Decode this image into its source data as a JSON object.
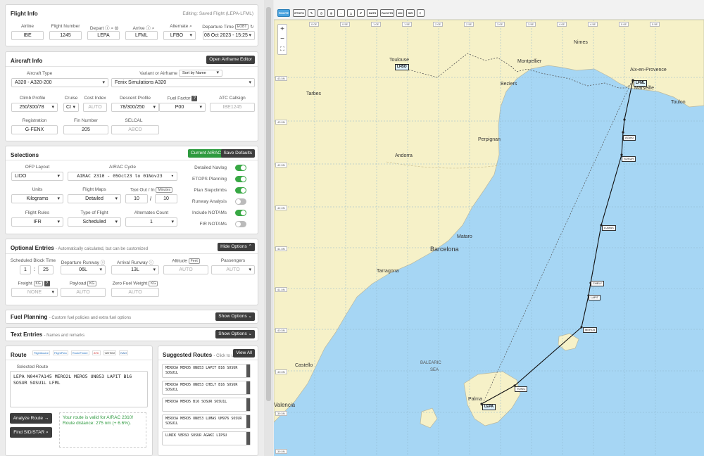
{
  "flight_info": {
    "title": "Flight Info",
    "editing": "Editing: Saved Flight (LEPA-LFML)",
    "labels": {
      "airline": "Airline",
      "flight_number": "Flight Number",
      "depart": "Depart",
      "arrive": "Arrive",
      "alternate": "Alternate",
      "departure_time": "Departure Time",
      "departure_time_unit": "EOBT"
    },
    "values": {
      "airline": "IBE",
      "flight_number": "1245",
      "depart": "LEPA",
      "arrive": "LFML",
      "alternate": "LFBO",
      "departure_time": "08 Oct 2023 - 15:25"
    }
  },
  "aircraft_info": {
    "title": "Aircraft Info",
    "open_editor": "Open Airframe Editor",
    "labels": {
      "aircraft_type": "Aircraft Type",
      "variant": "Variant or Airframe",
      "climb": "Climb Profile",
      "cruise": "Cruise",
      "cost_index": "Cost Index",
      "descent": "Descent Profile",
      "fuel_factor": "Fuel Factor",
      "atc_callsign": "ATC Callsign",
      "registration": "Registration",
      "fin_number": "Fin Number",
      "selcal": "SELCAL"
    },
    "sort_by": "Sort by Name",
    "values": {
      "aircraft_type": "A320 - A320-200",
      "variant": "Fenix Simulations A320",
      "climb": "250/300/78",
      "cruise": "CI",
      "cost_index": "AUTO",
      "descent": "78/300/250",
      "fuel_factor": "P00",
      "atc_callsign": "IBE1245",
      "registration": "G-FENX",
      "fin_number": "205",
      "selcal": "ABCD"
    }
  },
  "selections": {
    "title": "Selections",
    "current_airac": "Current AIRAC",
    "save_defaults": "Save Defaults",
    "labels": {
      "ofp_layout": "OFP Layout",
      "airac_cycle": "AIRAC Cycle",
      "units": "Units",
      "flight_maps": "Flight Maps",
      "taxi": "Taxi Out / In",
      "taxi_unit": "Minutes",
      "flight_rules": "Flight Rules",
      "type_of_flight": "Type of Flight",
      "alternates_count": "Alternates Count"
    },
    "values": {
      "ofp_layout": "LIDO",
      "airac_cycle": "AIRAC 2310 - 05Oct23 to 01Nov23",
      "units": "Kilograms",
      "flight_maps": "Detailed",
      "taxi_out": "10",
      "taxi_sep": "/",
      "taxi_in": "10",
      "flight_rules": "IFR",
      "type_of_flight": "Scheduled",
      "alternates_count": "1"
    },
    "toggles": [
      {
        "label": "Detailed Navlog",
        "on": true
      },
      {
        "label": "ETOPS Planning",
        "on": true
      },
      {
        "label": "Plan Stepclimbs",
        "on": true
      },
      {
        "label": "Runway Analysis",
        "on": false
      },
      {
        "label": "Include NOTAMs",
        "on": true
      },
      {
        "label": "FIR NOTAMs",
        "on": false
      }
    ]
  },
  "optional": {
    "title": "Optional Entries",
    "subtitle": "- Automatically calculated, but can be customized",
    "hide": "Hide Options",
    "labels": {
      "block_time": "Scheduled Block Time",
      "dep_rwy": "Departure Runway",
      "arr_rwy": "Arrival Runway",
      "altitude": "Altitude",
      "altitude_unit": "Feet",
      "passengers": "Passengers",
      "freight": "Freight",
      "payload": "Payload",
      "zfw": "Zero Fuel Weight",
      "kg": "KG"
    },
    "values": {
      "block_h": "1",
      "block_sep": ":",
      "block_m": "25",
      "dep_rwy": "06L",
      "arr_rwy": "13L",
      "altitude": "AUTO",
      "passengers": "AUTO",
      "freight": "NONE",
      "payload": "AUTO",
      "zfw": "AUTO"
    }
  },
  "fuel_planning": {
    "title": "Fuel Planning",
    "subtitle": "- Custom fuel policies and extra fuel options",
    "show": "Show Options"
  },
  "text_entries": {
    "title": "Text Entries",
    "subtitle": "- Names and remarks",
    "show": "Show Options"
  },
  "route": {
    "title": "Route",
    "providers": [
      "FlightAware",
      "FlightPlan",
      "RouteFinder",
      "ATC",
      "VATSIM",
      "IVAO"
    ],
    "selected_label": "Selected Route",
    "selected_route": "LEPA N0447A145 MERO2L MERO5 UN853 LAPIT B16 SOSUR SOSU1L LFML",
    "analyze": "Analyze Route",
    "find_sid": "Find SID/STAR",
    "valid_msg": "Your route is valid for AIRAC 2310!",
    "distance": "Route distance: 275 nm (+ 6.6%)."
  },
  "suggested": {
    "title": "Suggested Routes",
    "sub": "- Click to use",
    "view_all": "View All",
    "items": [
      "MERO3A MERO5 UN853 LAPIT B16 SOSUR SOSU1L",
      "MERO3A MERO5 UN853 CHELY B16 SOSUR SOSU1L",
      "MERO3A MERO5 B16 SOSUR SOSU1L",
      "MERO3A MERO5 UN853 LUMAS UM976 SOSUR SOSU1L",
      "LUNIK VERSO SOSUR AGAKI LIPSU"
    ]
  },
  "map": {
    "toolbar": [
      "ROUTE",
      "ETOPS",
      "",
      "",
      "",
      "",
      "",
      "NATS",
      "PACOTS",
      "WX",
      "SIR",
      ""
    ],
    "zoom_in": "+",
    "zoom_out": "−",
    "fullscreen": "⛶",
    "lon_labels": [
      "0.0E",
      "0.5E",
      "1.0E",
      "1.5E",
      "2.0E",
      "2.5E",
      "3.0E",
      "3.5E",
      "4.0E",
      "4.5E",
      "5.0E",
      "5.5E"
    ],
    "lat_labels": [
      "43.5N",
      "43.0N",
      "42.5N",
      "42.0N",
      "41.5N",
      "41.0N",
      "40.5N",
      "40.0N",
      "39.5N",
      "39.0N"
    ],
    "cities": [
      "Toulouse",
      "Nimes",
      "Montpellier",
      "Aix-en-Provence",
      "Marseille",
      "Toulon",
      "Tarbes",
      "Beziers",
      "Perpignan",
      "Andorra",
      "Mataro",
      "Barcelona",
      "Tarragona",
      "Castello",
      "Valencia",
      "Palma",
      "BALEARIC",
      "SEA"
    ],
    "waypoints": [
      "AGAKI",
      "SOSUR",
      "LUMAS",
      "CHELY",
      "LAPIT",
      "MERO5",
      "TONIC"
    ],
    "airports": [
      "LFBO",
      "LFML",
      "LEPA"
    ]
  }
}
